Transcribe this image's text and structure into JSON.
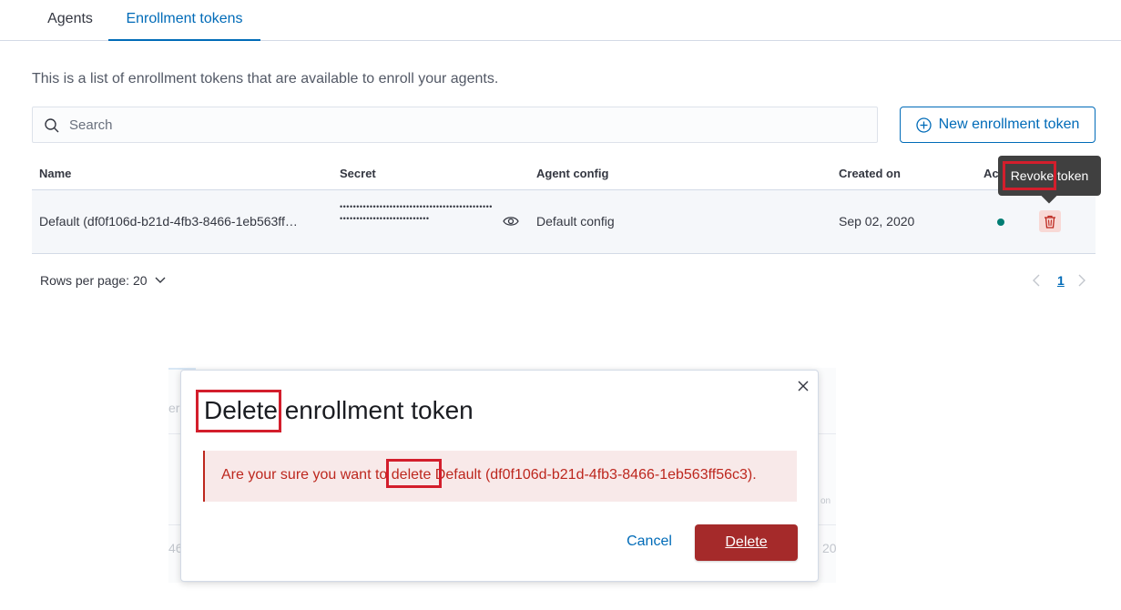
{
  "tabs": [
    {
      "label": "Agents",
      "active": false
    },
    {
      "label": "Enrollment tokens",
      "active": true
    }
  ],
  "description": "This is a list of enrollment tokens that are available to enroll your agents.",
  "search": {
    "placeholder": "Search"
  },
  "new_token_button": "New enrollment token",
  "table": {
    "headers": {
      "name": "Name",
      "secret": "Secret",
      "agent_config": "Agent config",
      "created_on": "Created on",
      "active": "Act"
    },
    "rows": [
      {
        "name": "Default (df0f106d-b21d-4fb3-8466-1eb563ff…",
        "secret": "•••••••••••••••••••••••••••••••••••••••••••••••••••••••••••••••••••••••••",
        "agent_config": "Default config",
        "created_on": "Sep 02, 2020",
        "status_color": "#017d73"
      }
    ]
  },
  "tooltip": {
    "text": "Revoke token"
  },
  "pagination": {
    "rows_per_page": "Rows per page: 20",
    "current_page": "1"
  },
  "ghost": {
    "left_fragment": "er",
    "left_fragment2": "46",
    "right_fragment": "on",
    "right_fragment2": "20"
  },
  "modal": {
    "title_word1": "Delete",
    "title_rest": " enrollment token",
    "message_prefix": "Are your sure you want to ",
    "message_word": "delete",
    "message_suffix": " Default (df0f106d-b21d-4fb3-8466-1eb563ff56c3).",
    "cancel_label": "Cancel",
    "delete_label": "Delete"
  },
  "colors": {
    "accent": "#006bb8",
    "danger": "#bd271e",
    "danger_button": "#a52a2a",
    "highlight": "#d31e2c"
  }
}
